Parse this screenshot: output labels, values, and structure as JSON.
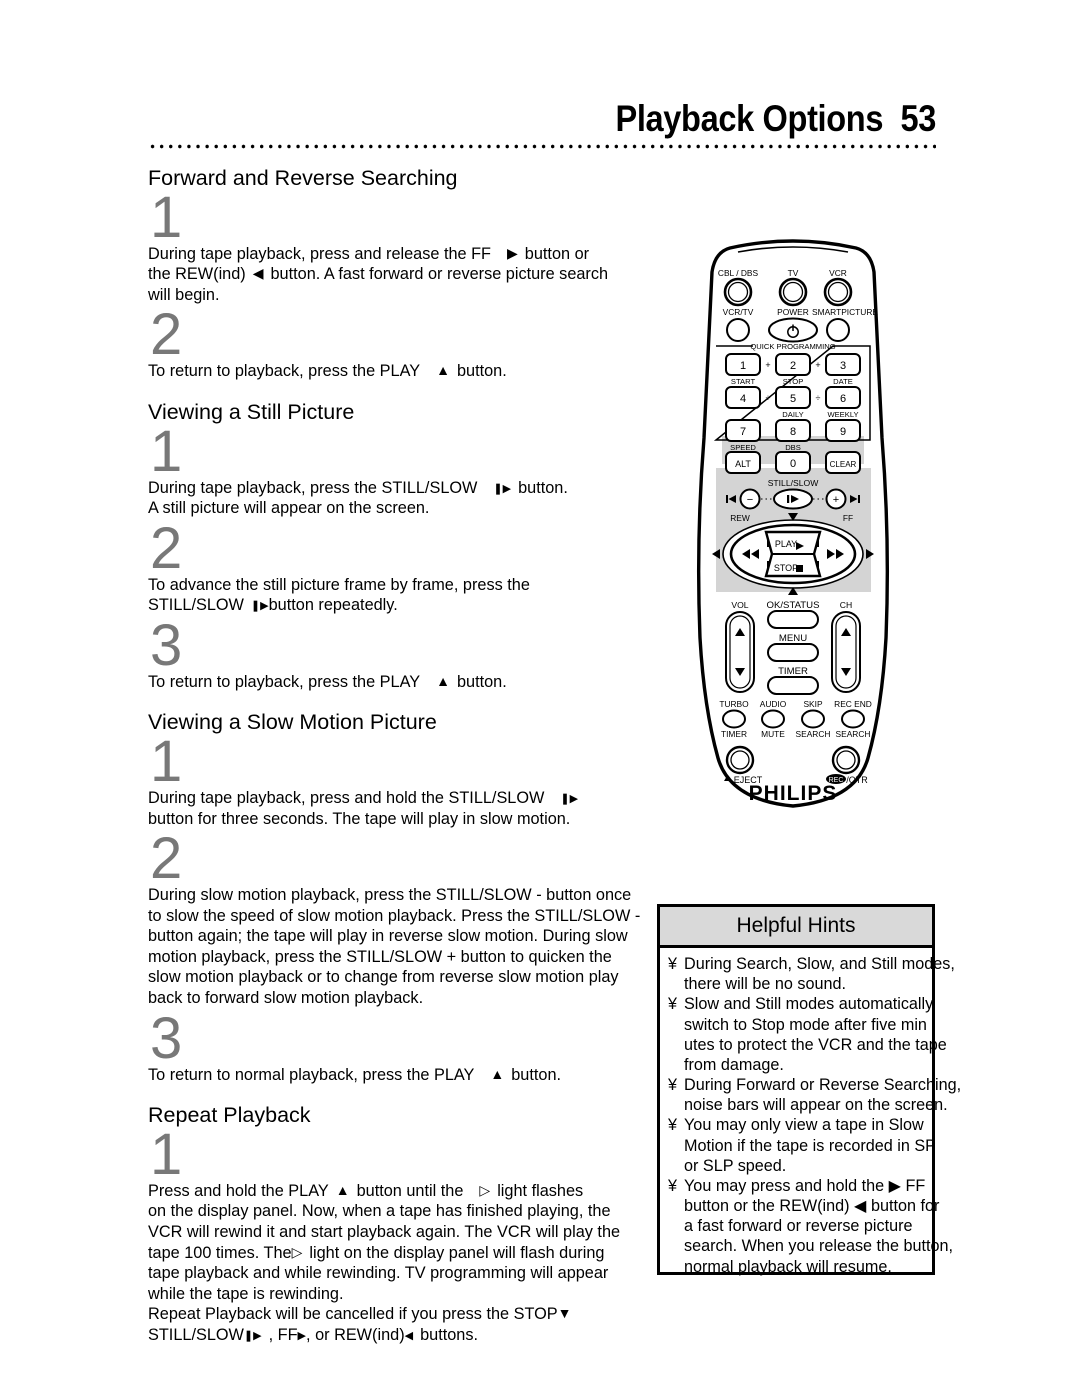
{
  "header": {
    "title": "Playback Options  53"
  },
  "sections": [
    {
      "heading": "Forward and Reverse Searching",
      "steps": [
        {
          "number": "1",
          "lines": [
            "During tape playback, press and release the FF",
            "the REW(ind)",
            "will begin."
          ],
          "text": "During tape playback, press and release the FF ▶ button or the REW(ind) ◀ button.  A fast forward or reverse picture search will begin."
        },
        {
          "number": "2",
          "text": "To return to playback, press the PLAY ▲ button."
        }
      ]
    },
    {
      "heading": "Viewing a Still Picture",
      "steps": [
        {
          "number": "1",
          "text": "During tape playback, press the STILL/SLOW ❚▶ button. A still picture will appear on the screen."
        },
        {
          "number": "2",
          "text": "To advance the still picture frame by frame, press the STILL/SLOW ❚▶ button repeatedly."
        },
        {
          "number": "3",
          "text": "To return to playback, press the PLAY ▲ button."
        }
      ]
    },
    {
      "heading": "Viewing a Slow Motion Picture",
      "steps": [
        {
          "number": "1",
          "text": "During tape playback, press and hold the STILL/SLOW ❚▶ button for three seconds.  The tape will play in slow motion."
        },
        {
          "number": "2",
          "text": "During slow motion playback, press the STILL/SLOW - button once to slow the speed of slow motion playback. Press the STILL/SLOW - button again; the tape will play in reverse slow motion. During slow motion playback, press the STILL/SLOW + button to quicken the slow motion playback or to change from reverse slow motion play back to forward slow motion playback."
        },
        {
          "number": "3",
          "text": "To return to normal playback, press the PLAY ▲ button."
        }
      ]
    },
    {
      "heading": "Repeat Playback",
      "steps": [
        {
          "number": "1",
          "text": "Press and hold the PLAY ▲ button until the ▷ light flashes on the display panel.  Now, when a tape has finished playing, the VCR will rewind it and start playback again. The VCR will play the tape 100 times. The ▷ light on the display panel will flash during tape playback and while rewinding. TV programming will appear while the tape is rewinding."
        }
      ]
    }
  ],
  "text_lines": {
    "s1_1_a": "During tape playback, press and release the FF",
    "s1_1_b": "button or",
    "s1_1_c": "the REW(ind)",
    "s1_1_d": "button.  A fast forward or reverse picture search",
    "s1_1_e": "will begin.",
    "s1_2_a": "To return to playback, press the PLAY",
    "s1_2_b": "button.",
    "s2_1_a": "During tape playback, press the STILL/SLOW",
    "s2_1_b": "button.",
    "s2_1_c": "A still picture will appear on the screen.",
    "s2_2_a": "To advance the still picture frame by frame, press the",
    "s2_2_b": "STILL/SLOW",
    "s2_2_c": "button repeatedly.",
    "s2_3_a": "To return to playback, press the PLAY",
    "s2_3_b": "button.",
    "s3_1_a": "During tape playback, press and hold the STILL/SLOW",
    "s3_1_b": "button for three seconds.   The tape will play in slow motion.",
    "s3_2_a": "During slow motion playback, press the STILL/SLOW - button once",
    "s3_2_b": "to slow the speed of slow motion playback. Press the STILL/SLOW -",
    "s3_2_c": "button again; the tape will play in reverse slow motion. During slow",
    "s3_2_d": "motion playback, press the STILL/SLOW + button to quicken the",
    "s3_2_e": "slow motion playback or to change from reverse slow motion play",
    "s3_2_f": "back to forward slow motion playback.",
    "s3_3_a": "To return to normal playback, press the PLAY",
    "s3_3_b": "button.",
    "s4_1_a": "Press and hold the PLAY",
    "s4_1_b": "button until the",
    "s4_1_c": "light flashes",
    "s4_1_d": "on the display panel.  Now, when a tape has finished playing, the",
    "s4_1_e": "VCR will rewind it and start playback again. The VCR will play the",
    "s4_1_f": "tape 100 times. The",
    "s4_1_g": "light on the display panel will flash during",
    "s4_1_h": "tape playback and while rewinding. TV programming will appear",
    "s4_1_i": "while the tape is rewinding.",
    "s4_1_j": "Repeat Playback will be cancelled if you press the STOP",
    "s4_1_k": "STILL/SLOW",
    "s4_1_l": ", FF",
    "s4_1_m": ", or REW(ind)",
    "s4_1_n": "buttons."
  },
  "glyphs": {
    "play_right": "▶",
    "rew_left": "◀",
    "play_up": "▲",
    "stop_down": "▼",
    "still_slow": "❚▶",
    "play_hollow": "▷"
  },
  "hints": {
    "title": "Helpful Hints",
    "bullet": "¥",
    "items": [
      [
        "During Search, Slow, and Still modes,",
        "there will be no sound."
      ],
      [
        "Slow and Still modes automatically",
        "switch to Stop mode after five min",
        "utes to protect the VCR and the tape",
        "from damage."
      ],
      [
        "During Forward or Reverse Searching,",
        "noise bars will appear on the screen."
      ],
      [
        "You may only view a tape in Slow",
        "Motion if the tape is recorded in SP",
        "or SLP speed."
      ],
      [
        "You may press and hold the ▶ FF",
        "button or the REW(ind) ◀ button for",
        "a fast forward or reverse picture",
        "search. When you release the button,",
        "normal playback will resume."
      ]
    ]
  },
  "remote": {
    "brand": "PHILIPS",
    "source_buttons": [
      "CBL / DBS",
      "TV",
      "VCR"
    ],
    "second_row": [
      "VCR/TV",
      "POWER",
      "SMARTPICTURE"
    ],
    "keypad_frame_label": "QUICK PROGRAMMING",
    "keypad": [
      {
        "key": "1",
        "label": "START"
      },
      {
        "key": "2",
        "label": "STOP"
      },
      {
        "key": "3",
        "label": "DATE"
      },
      {
        "key": "4",
        "label": ""
      },
      {
        "key": "5",
        "label": "DAILY"
      },
      {
        "key": "6",
        "label": "WEEKLY"
      },
      {
        "key": "7",
        "label": "SPEED"
      },
      {
        "key": "8",
        "label": "DBS"
      },
      {
        "key": "9",
        "label": ""
      },
      {
        "key": "ALT",
        "label": ""
      },
      {
        "key": "0",
        "label": ""
      },
      {
        "key": "CLEAR",
        "label": ""
      }
    ],
    "keypad_plus": [
      "+",
      "+",
      "÷",
      "÷"
    ],
    "still_slow": {
      "label": "STILL/SLOW",
      "minus": "−",
      "plus": "+",
      "center": "❚▶",
      "left_icon": "⏮",
      "right_icon": "⏭"
    },
    "transport": {
      "rew_label": "REW",
      "ff_label": "FF",
      "play_label": "PLAY",
      "stop_label": "STOP",
      "rew_icon": "◀◀",
      "ff_icon": "▶▶",
      "play_icon": "▶",
      "stop_icon": "■",
      "up_arrow": "▲",
      "down_arrow": "▼",
      "left_arrow": "◀",
      "right_arrow": "▶"
    },
    "vol_label": "VOL",
    "ch_label": "CH",
    "center_buttons": [
      "OK/STATUS",
      "MENU",
      "TIMER"
    ],
    "function_row_top": [
      "TURBO",
      "AUDIO",
      "SKIP",
      "REC END"
    ],
    "function_row_bottom": [
      "TIMER",
      "MUTE",
      "SEARCH",
      "SEARCH"
    ],
    "eject_label": "EJECT",
    "eject_icon": "▲",
    "rec_label": "REC",
    "otr_label": "/OTR",
    "arrow_up": "▲",
    "arrow_down": "▼",
    "power_icon": "⏻"
  }
}
